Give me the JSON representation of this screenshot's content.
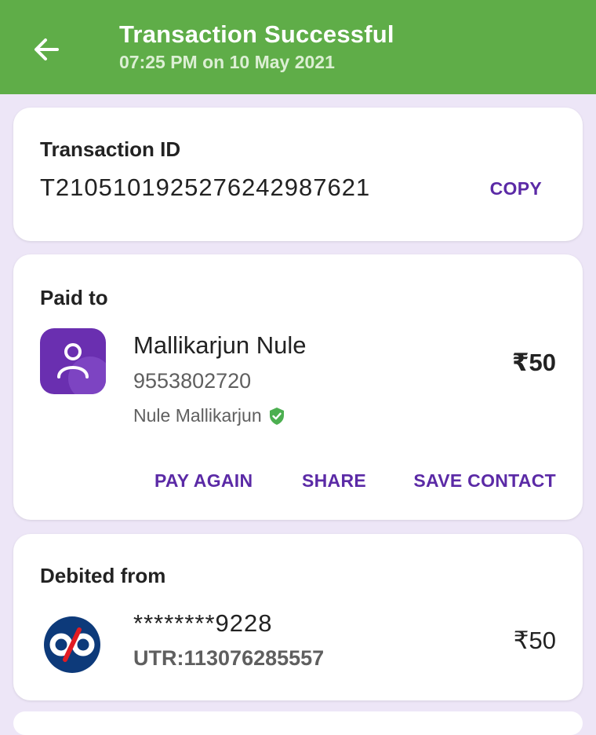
{
  "header": {
    "title": "Transaction Successful",
    "subtitle": "07:25 PM on 10 May 2021",
    "back_icon": "arrow-left-icon",
    "background_color": "#5fad48"
  },
  "transaction": {
    "label": "Transaction ID",
    "id": "T2105101925276242987621",
    "copy_label": "COPY"
  },
  "paid_to": {
    "heading": "Paid to",
    "name": "Mallikarjun Nule",
    "phone": "9553802720",
    "verified_name": "Nule Mallikarjun",
    "verified_icon": "verified-shield-icon",
    "amount": "₹50",
    "actions": {
      "pay_again": "PAY AGAIN",
      "share": "SHARE",
      "save_contact": "SAVE CONTACT"
    }
  },
  "debited_from": {
    "heading": "Debited from",
    "account": "********9228",
    "utr": "UTR:113076285557",
    "amount": "₹50",
    "bank_icon": "kotak-bank-logo-icon"
  },
  "colors": {
    "accent": "#5b2aa6",
    "background": "#ede6f7",
    "verified": "#4caf50"
  }
}
